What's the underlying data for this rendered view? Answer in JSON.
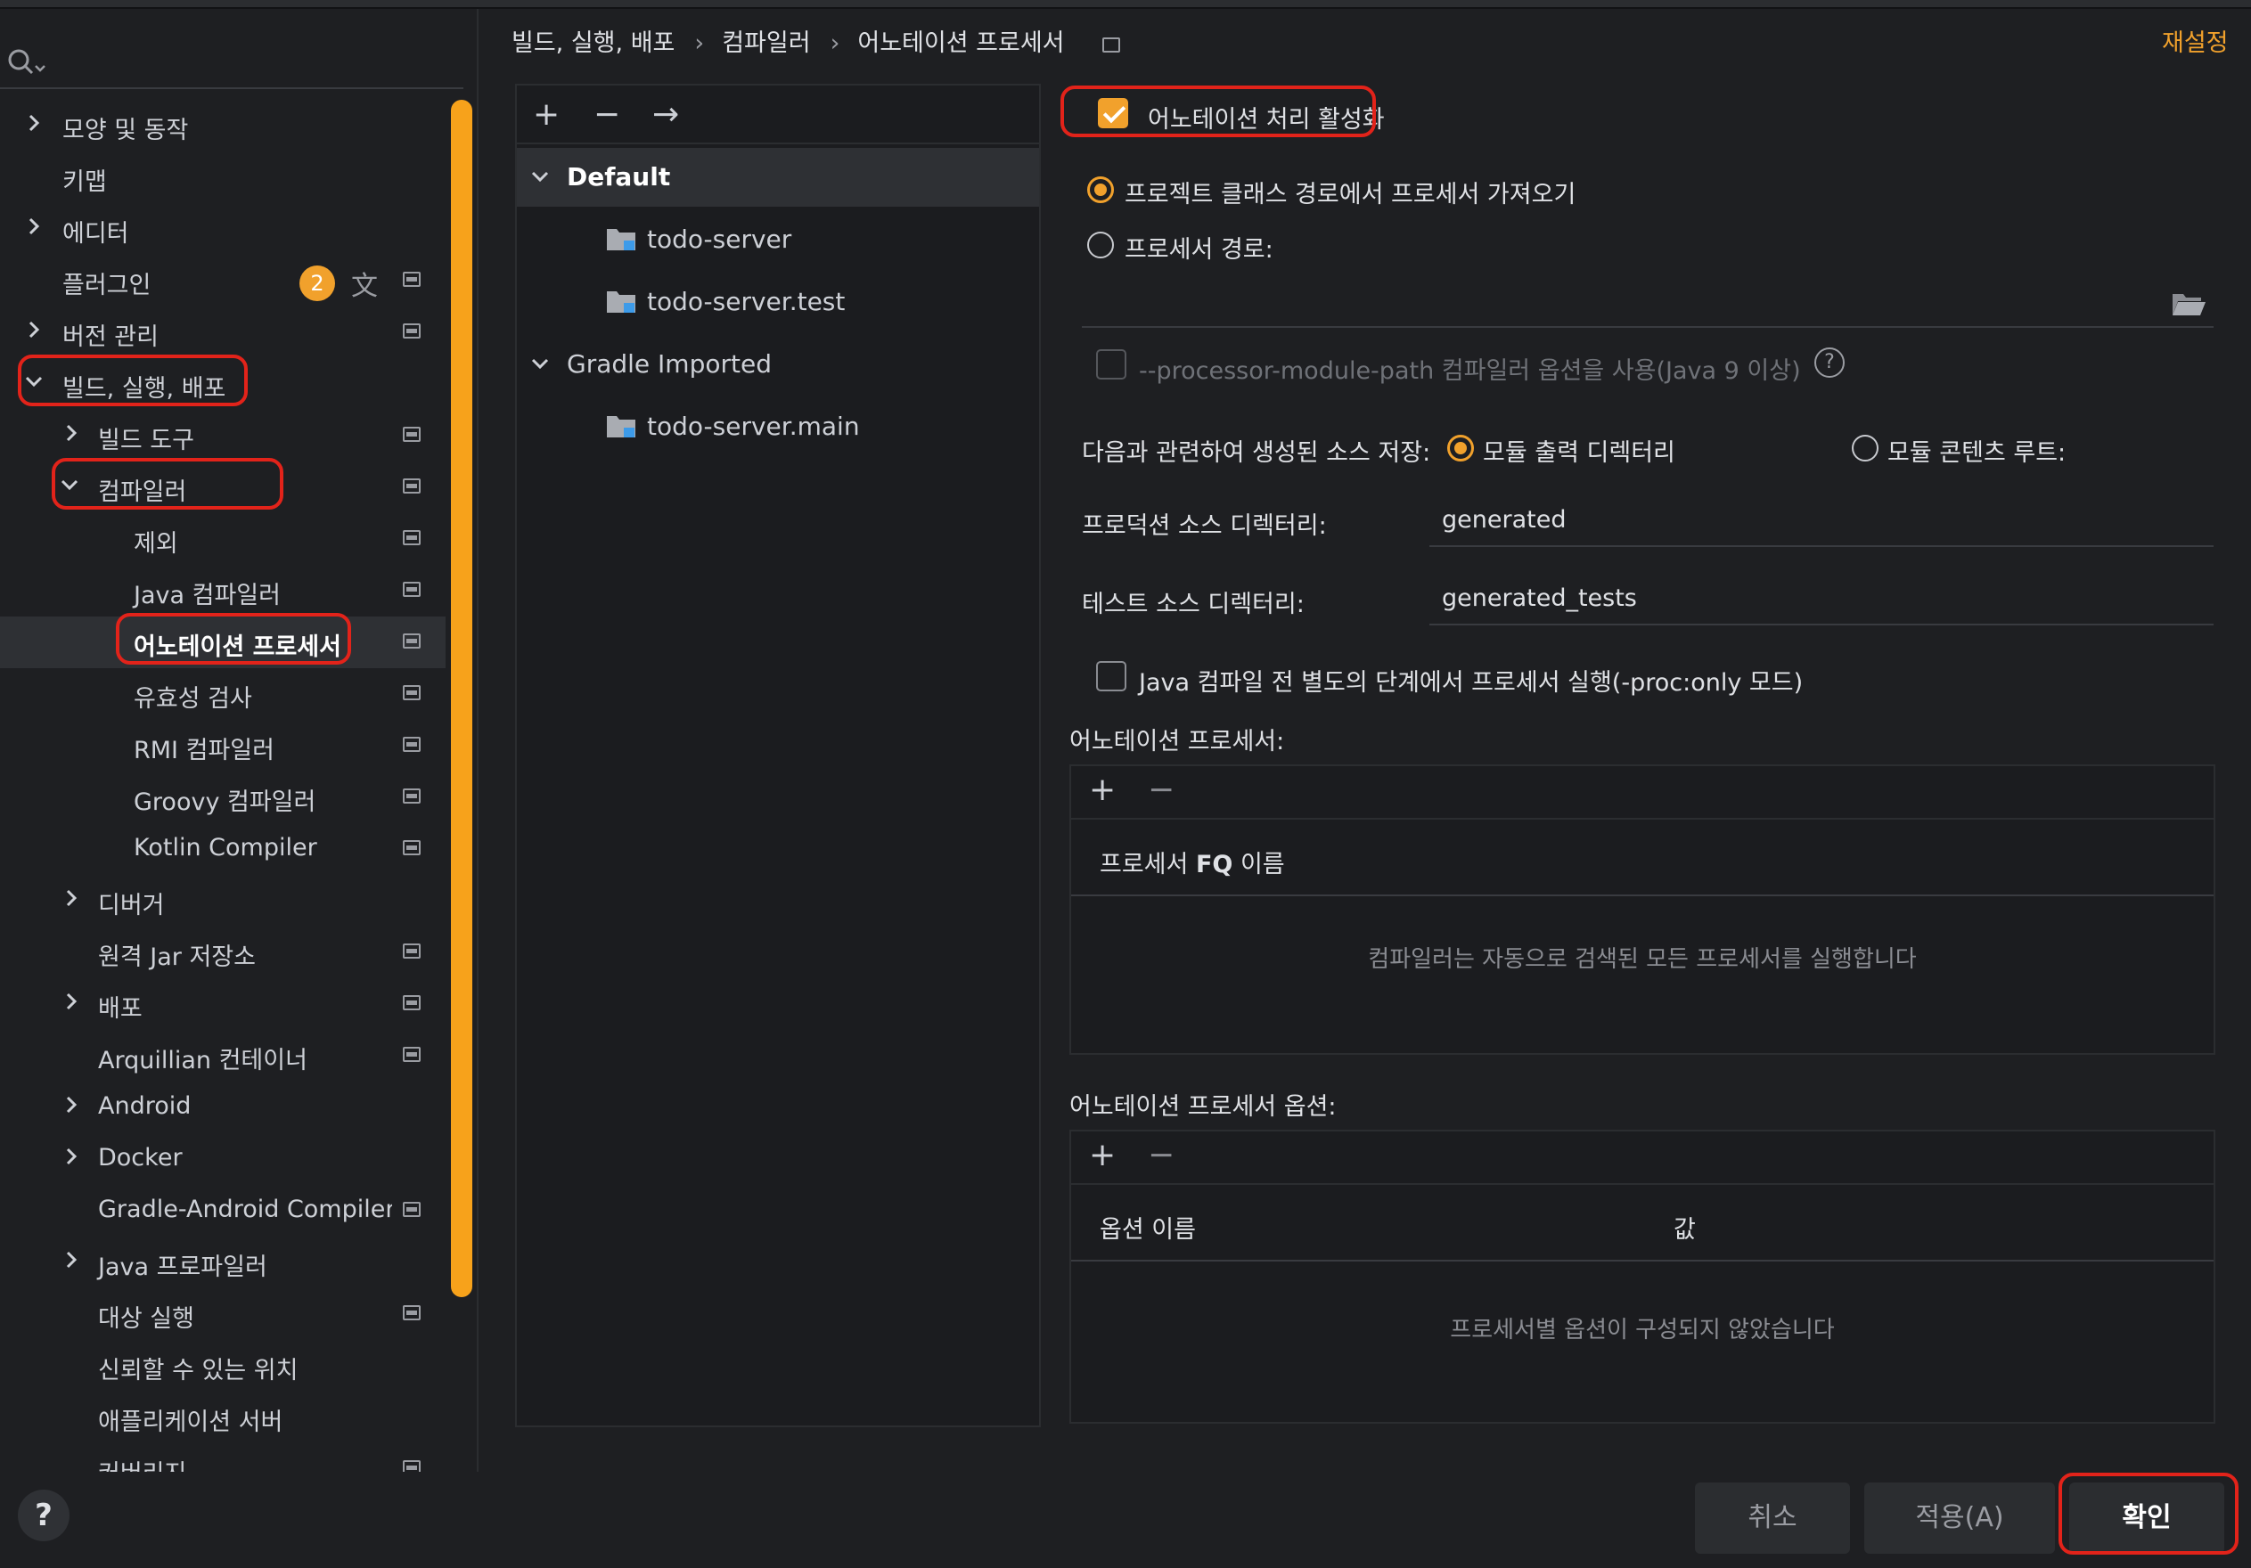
{
  "colors": {
    "accent": "#f1a12c",
    "highlight_red": "#e2231a",
    "background": "#1e1f22"
  },
  "sidebar": {
    "search_icon": "search-icon",
    "items": [
      {
        "label": "모양 및 동작"
      },
      {
        "label": "키맵"
      },
      {
        "label": "에디터"
      },
      {
        "label": "플러그인",
        "badge": "2"
      },
      {
        "label": "버전 관리"
      },
      {
        "label": "빌드, 실행, 배포"
      },
      {
        "label": "빌드 도구"
      },
      {
        "label": "컴파일러"
      },
      {
        "label": "제외"
      },
      {
        "label": "Java 컴파일러"
      },
      {
        "label": "어노테이션 프로세서"
      },
      {
        "label": "유효성 검사"
      },
      {
        "label": "RMI 컴파일러"
      },
      {
        "label": "Groovy 컴파일러"
      },
      {
        "label": "Kotlin Compiler"
      },
      {
        "label": "디버거"
      },
      {
        "label": "원격 Jar 저장소"
      },
      {
        "label": "배포"
      },
      {
        "label": "Arquillian 컨테이너"
      },
      {
        "label": "Android"
      },
      {
        "label": "Docker"
      },
      {
        "label": "Gradle-Android Compiler"
      },
      {
        "label": "Java 프로파일러"
      },
      {
        "label": "대상 실행"
      },
      {
        "label": "신뢰할 수 있는 위치"
      },
      {
        "label": "애플리케이션 서버"
      },
      {
        "label": "커버리지"
      }
    ]
  },
  "breadcrumb": {
    "part1": "빌드, 실행, 배포",
    "part2": "컴파일러",
    "part3": "어노테이션 프로세서"
  },
  "reset_label": "재설정",
  "modules": {
    "tools": {
      "add": "+",
      "remove": "−",
      "move": "→"
    },
    "rows": [
      {
        "label": "Default"
      },
      {
        "label": "todo-server"
      },
      {
        "label": "todo-server.test"
      },
      {
        "label": "Gradle Imported"
      },
      {
        "label": "todo-server.main"
      }
    ]
  },
  "settings": {
    "enable_label": "어노테이션 처리 활성화",
    "enable_checked": true,
    "radio_classpath": "프로젝트 클래스 경로에서 프로세서 가져오기",
    "radio_path": "프로세서 경로:",
    "module_path_option": "--processor-module-path 컴파일러 옵션을 사용(Java 9 이상)",
    "help_q": "?",
    "store_label": "다음과 관련하여 생성된 소스 저장:",
    "radio_module_output": "모듈 출력 디렉터리",
    "radio_content_root": "모듈 콘텐츠 루트:",
    "production_dir_label": "프로덕션 소스 디렉터리:",
    "production_dir_value": "generated",
    "test_dir_label": "테스트 소스 디렉터리:",
    "test_dir_value": "generated_tests",
    "proc_only_label": "Java 컴파일 전 별도의 단계에서 프로세서 실행(-proc:only 모드)",
    "processors_title": "어노테이션 프로세서:",
    "processors_header_prefix": "프로세서 ",
    "processors_header_bold": "FQ",
    "processors_header_suffix": " 이름",
    "processors_empty": "컴파일러는 자동으로 검색된 모든 프로세서를 실행합니다",
    "options_title": "어노테이션 프로세서 옵션:",
    "options_col_name": "옵션 이름",
    "options_col_value": "값",
    "options_empty": "프로세서별 옵션이 구성되지 않았습니다",
    "plus": "+",
    "minus": "−"
  },
  "buttons": {
    "cancel": "취소",
    "apply": "적용(A)",
    "ok": "확인",
    "help": "?"
  }
}
